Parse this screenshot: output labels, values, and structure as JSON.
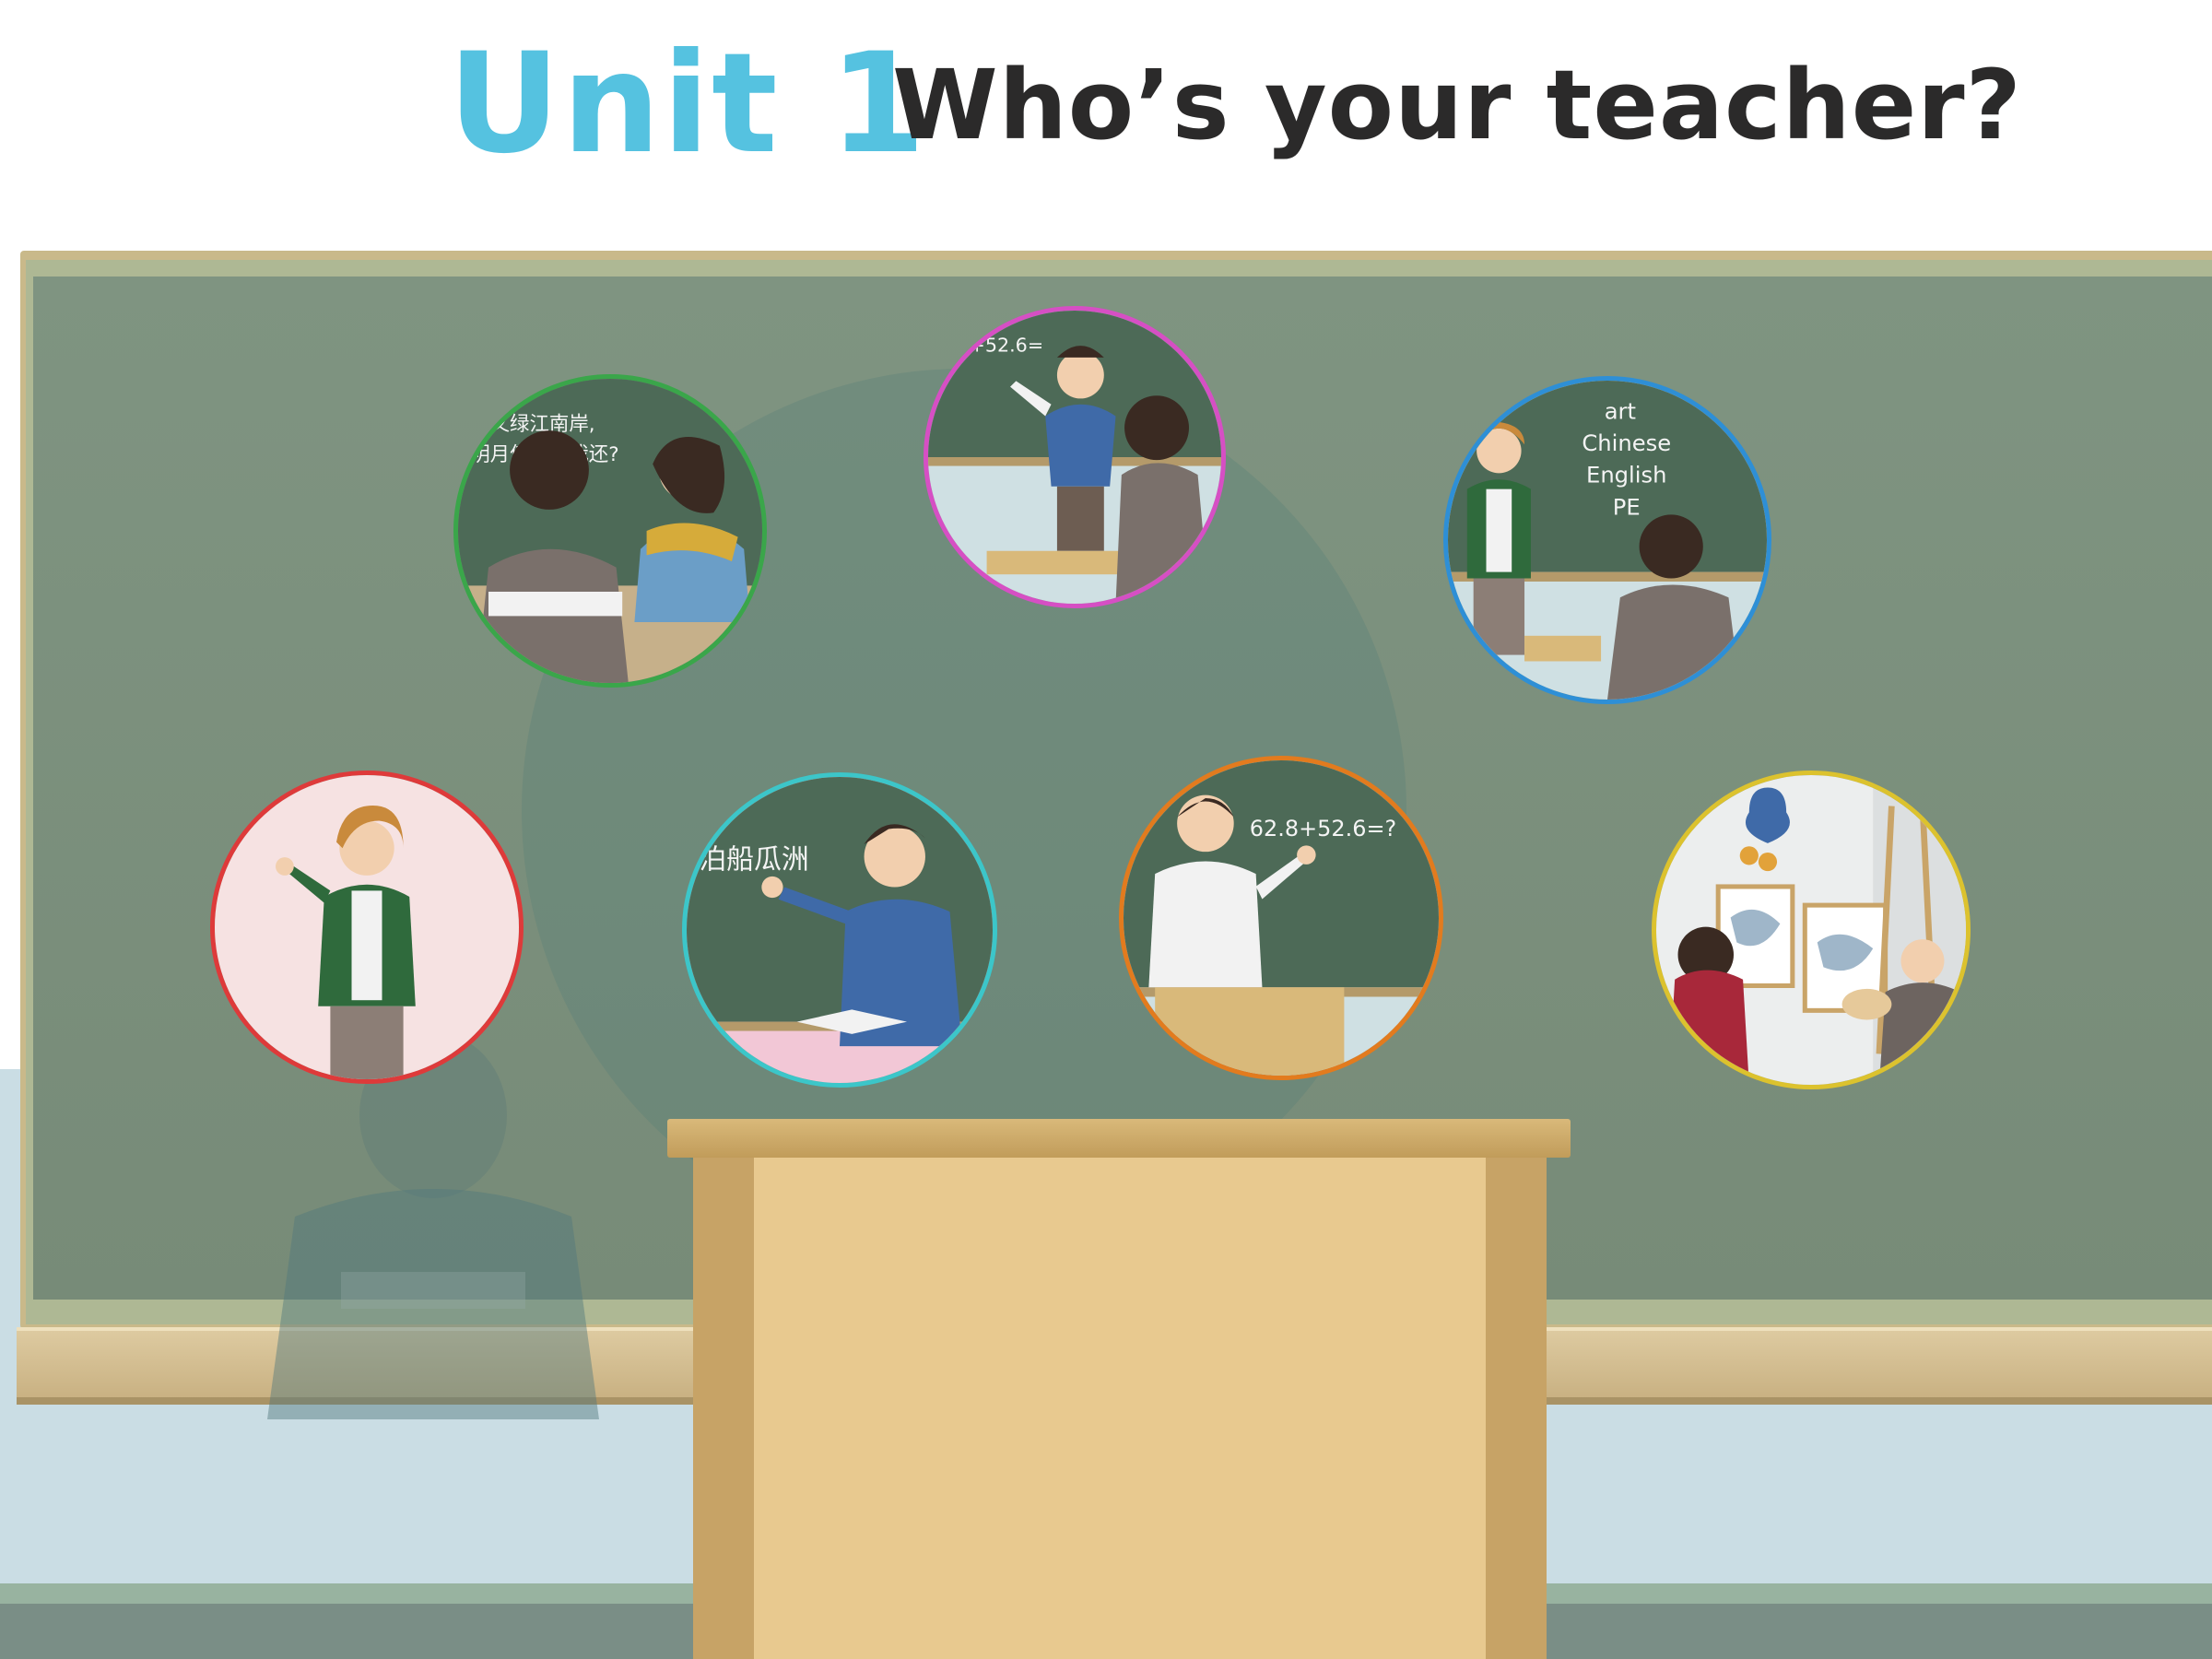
{
  "title": {
    "unit": "Unit 1",
    "question": "Who’s your teacher?"
  },
  "scenes": [
    {
      "name": "chinese-class",
      "board_text_line1": "风又绿江南岸,",
      "board_text_line2": "明月何时照我还?"
    },
    {
      "name": "math-class-student",
      "board_text": "+52.6="
    },
    {
      "name": "subjects-board",
      "subjects": [
        "art",
        "Chinese",
        "English",
        "PE"
      ]
    },
    {
      "name": "female-teacher-portrait"
    },
    {
      "name": "chinese-teacher",
      "board_text": "泊船瓜洲"
    },
    {
      "name": "math-teacher",
      "board_text": "62.8+52.6=?"
    },
    {
      "name": "art-class"
    }
  ],
  "colors": {
    "title_unit": "#55c2e0",
    "title_question": "#2b2a2a",
    "blackboard": "#7f9481",
    "podium": "#e8c98f"
  }
}
